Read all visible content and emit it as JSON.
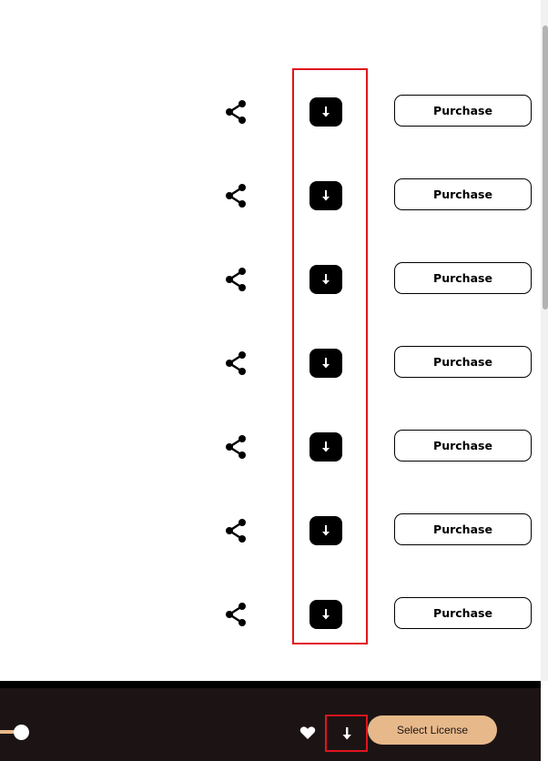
{
  "tracks": [
    {
      "purchase_label": "Purchase"
    },
    {
      "purchase_label": "Purchase"
    },
    {
      "purchase_label": "Purchase"
    },
    {
      "purchase_label": "Purchase"
    },
    {
      "purchase_label": "Purchase"
    },
    {
      "purchase_label": "Purchase"
    },
    {
      "purchase_label": "Purchase"
    }
  ],
  "icons": {
    "share": "share-icon",
    "download": "download-arrow-icon",
    "heart": "heart-icon"
  },
  "player": {
    "select_license_label": "Select License",
    "progress_fraction": 0.03
  },
  "colors": {
    "accent": "#e7b98a",
    "player_bg": "#1c1414",
    "highlight": "#e0141e",
    "button_dark": "#000000"
  }
}
